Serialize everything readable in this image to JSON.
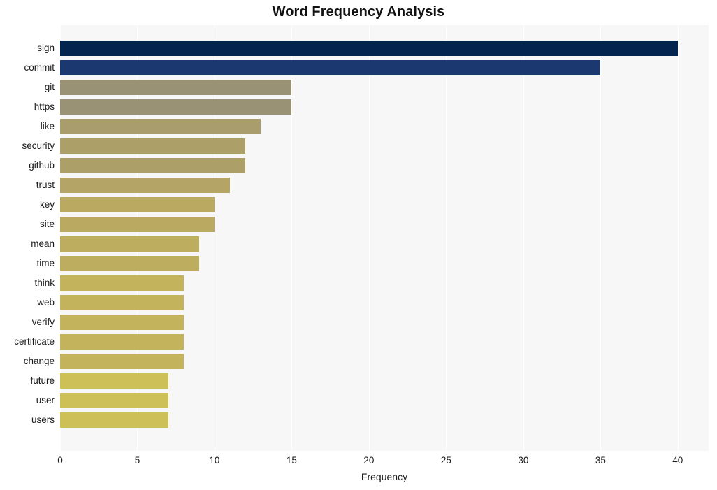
{
  "chart_data": {
    "type": "bar",
    "orientation": "horizontal",
    "title": "Word Frequency Analysis",
    "xlabel": "Frequency",
    "ylabel": "",
    "categories": [
      "sign",
      "commit",
      "git",
      "https",
      "like",
      "security",
      "github",
      "trust",
      "key",
      "site",
      "mean",
      "time",
      "think",
      "web",
      "verify",
      "certificate",
      "change",
      "future",
      "user",
      "users"
    ],
    "values": [
      40,
      35,
      15,
      15,
      13,
      12,
      12,
      11,
      10,
      10,
      9,
      9,
      8,
      8,
      8,
      8,
      8,
      7,
      7,
      7
    ],
    "bar_colors": [
      "#042450",
      "#1b3870",
      "#999275",
      "#999275",
      "#a99c6d",
      "#ad9f68",
      "#ad9f68",
      "#b4a566",
      "#b9a961",
      "#b9a961",
      "#bdad5f",
      "#bdad5f",
      "#c2b35c",
      "#c2b35c",
      "#c2b35c",
      "#c2b35c",
      "#c2b35c",
      "#cdc057",
      "#cdc057",
      "#cdc057"
    ],
    "xlim": [
      0,
      42
    ],
    "xticks": [
      0,
      5,
      10,
      15,
      20,
      25,
      30,
      35,
      40
    ],
    "xtick_labels": [
      "0",
      "5",
      "10",
      "15",
      "20",
      "25",
      "30",
      "35",
      "40"
    ],
    "grid": true,
    "grid_axis": "x",
    "legend": false,
    "plot_background": "#f7f7f7",
    "figure_background": "#ffffff",
    "gridline_color": "#ffffff"
  }
}
